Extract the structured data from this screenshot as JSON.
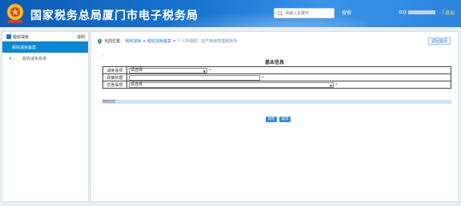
{
  "header": {
    "site_title": "国家税务总局厦门市电子税务局",
    "search_placeholder": "请输入关键字",
    "search_button": "搜索",
    "welcome_label": "欢迎",
    "divider": "|",
    "logout": "退出"
  },
  "sidebar": {
    "title": "税收减免",
    "title_right": "说明",
    "items": [
      {
        "label": "税收减免备案",
        "active": true
      },
      {
        "label": "税收减免核准",
        "active": false
      }
    ]
  },
  "main": {
    "breadcrumb": {
      "prefix": "当前位置：",
      "items": [
        "税收减免",
        "税收减免备案"
      ],
      "current": "个人所得税、资产等级管理税务所"
    },
    "back_button": "返回首页",
    "tiny_mark": "\\",
    "section_title": "基本信息",
    "form": {
      "rows": [
        {
          "label": "减免事项",
          "type": "select",
          "value": "请选择",
          "required": "*"
        },
        {
          "label": "政策依据",
          "type": "text",
          "value": "",
          "required": "*"
        },
        {
          "label": "优惠事项",
          "type": "select",
          "value": "请选择",
          "required": "*"
        }
      ]
    },
    "band_label": "税务信息",
    "buttons": {
      "save": "保存",
      "cancel": "取消"
    }
  },
  "colors": {
    "header_blue": "#1a76d2",
    "active_item": "#0c87d2",
    "button_blue": "#3a87d6",
    "logout_yellow": "#ffd65c"
  }
}
